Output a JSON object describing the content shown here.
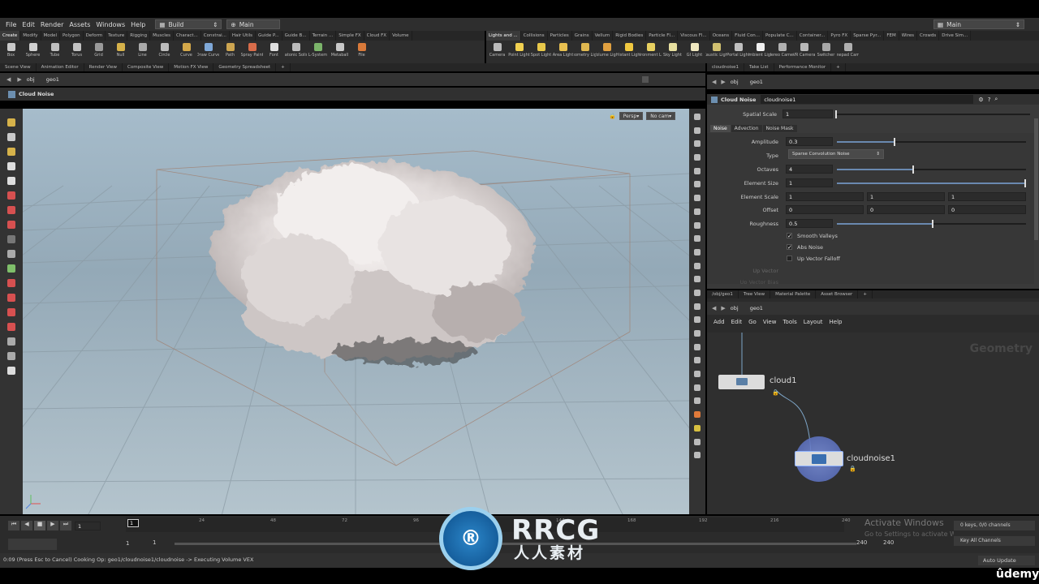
{
  "menubar": {
    "items": [
      "File",
      "Edit",
      "Render",
      "Assets",
      "Windows",
      "Help"
    ],
    "desktop": "Build",
    "context": "Main",
    "right_context": "Main"
  },
  "shelf_left": {
    "tabs": [
      "Create",
      "Modify",
      "Model",
      "Polygon",
      "Deform",
      "Texture",
      "Rigging",
      "Muscles",
      "Charact...",
      "Constrai...",
      "Hair Utils",
      "Guide P...",
      "Guide B...",
      "Terrain ...",
      "Simple FX",
      "Cloud FX",
      "Volume"
    ],
    "tools": [
      {
        "label": "Box",
        "color": "#c9c9c9"
      },
      {
        "label": "Sphere",
        "color": "#d0d0d0"
      },
      {
        "label": "Tube",
        "color": "#c0c0c0"
      },
      {
        "label": "Torus",
        "color": "#c4c4c4"
      },
      {
        "label": "Grid",
        "color": "#9a9a9a"
      },
      {
        "label": "Null",
        "color": "#d6b24a"
      },
      {
        "label": "Line",
        "color": "#aaaaaa"
      },
      {
        "label": "Circle",
        "color": "#bdbdbd"
      },
      {
        "label": "Curve",
        "color": "#d4a84a"
      },
      {
        "label": "Draw Curve",
        "color": "#7fa8d8"
      },
      {
        "label": "Path",
        "color": "#cda550"
      },
      {
        "label": "Spray Paint",
        "color": "#d86c4a"
      },
      {
        "label": "Font",
        "color": "#e0e0e0"
      },
      {
        "label": "Platonic Solids",
        "color": "#bbbbbb"
      },
      {
        "label": "L-System",
        "color": "#7bb46a"
      },
      {
        "label": "Metaball",
        "color": "#c8c8c8"
      },
      {
        "label": "File",
        "color": "#d97a3a"
      }
    ]
  },
  "shelf_right": {
    "tabs": [
      "Lights and ...",
      "Collisions",
      "Particles",
      "Grains",
      "Vellum",
      "Rigid Bodies",
      "Particle Fl...",
      "Viscous Fl...",
      "Oceans",
      "Fluid Con...",
      "Populate C...",
      "Container...",
      "Pyro FX",
      "Sparse Pyr...",
      "FEM",
      "Wires",
      "Crowds",
      "Drive Sim..."
    ],
    "tools": [
      {
        "label": "Camera",
        "color": "#bbbbbb"
      },
      {
        "label": "Point Light",
        "color": "#f0d050"
      },
      {
        "label": "Spot Light",
        "color": "#e8c84a"
      },
      {
        "label": "Area Light",
        "color": "#e8c050"
      },
      {
        "label": "Geometry Light",
        "color": "#e0b850"
      },
      {
        "label": "Volume Light",
        "color": "#e0a040"
      },
      {
        "label": "Distant Light",
        "color": "#f0c840"
      },
      {
        "label": "Environment Light",
        "color": "#e8d060"
      },
      {
        "label": "Sky Light",
        "color": "#e8e0a0"
      },
      {
        "label": "GI Light",
        "color": "#f0e8c0"
      },
      {
        "label": "Caustic Light",
        "color": "#d0c070"
      },
      {
        "label": "Portal Light",
        "color": "#c0c0c0"
      },
      {
        "label": "Ambient Light",
        "color": "#f0f0f0"
      },
      {
        "label": "Stereo Camera",
        "color": "#b0b0b0"
      },
      {
        "label": "VR Camera",
        "color": "#b8b8b8"
      },
      {
        "label": "Switcher",
        "color": "#a8a8a8"
      },
      {
        "label": "Gamepad Camera",
        "color": "#b0b0b0"
      }
    ]
  },
  "left_pane": {
    "tabs": [
      "Scene View",
      "Animation Editor",
      "Render View",
      "Composite View",
      "Motion FX View",
      "Geometry Spreadsheet"
    ],
    "path": [
      "obj",
      "geo1"
    ],
    "title": "Cloud Noise",
    "persp": "Persp",
    "cam": "No cam"
  },
  "param_pane": {
    "tabs": [
      "cloudnoise1",
      "Take List",
      "Performance Monitor"
    ],
    "path": [
      "obj",
      "geo1"
    ],
    "node_type": "Cloud Noise",
    "node_name": "cloudnoise1",
    "spatial_scale": {
      "label": "Spatial Scale",
      "value": "1"
    },
    "subtabs": [
      "Noise",
      "Advection",
      "Noise Mask"
    ],
    "amplitude": {
      "label": "Amplitude",
      "value": "0.3",
      "fraction": 0.3
    },
    "type": {
      "label": "Type",
      "value": "Sparse Convolution Noise"
    },
    "octaves": {
      "label": "Octaves",
      "value": "4",
      "fraction": 0.4
    },
    "element_size": {
      "label": "Element Size",
      "value": "1",
      "fraction": 1.0
    },
    "element_scale": {
      "label": "Element Scale",
      "values": [
        "1",
        "1",
        "1"
      ]
    },
    "offset": {
      "label": "Offset",
      "values": [
        "0",
        "0",
        "0"
      ]
    },
    "roughness": {
      "label": "Roughness",
      "value": "0.5",
      "fraction": 0.5
    },
    "smooth_valleys": {
      "label": "Smooth Valleys",
      "checked": true
    },
    "abs_noise": {
      "label": "Abs Noise",
      "checked": true
    },
    "up_vector_falloff": {
      "label": "Up Vector Falloff",
      "checked": false
    },
    "up_vector": {
      "label": "Up Vector"
    },
    "up_vector_bias": {
      "label": "Up Vector Bias"
    }
  },
  "network_pane": {
    "tabs": [
      "/obj/geo1",
      "Tree View",
      "Material Palette",
      "Asset Browser"
    ],
    "path": [
      "obj",
      "geo1"
    ],
    "menu": [
      "Add",
      "Edit",
      "Go",
      "View",
      "Tools",
      "Layout",
      "Help"
    ],
    "watermark": "Geometry",
    "nodes": [
      "cloud1",
      "cloudnoise1"
    ]
  },
  "timeline": {
    "frame": "1",
    "ticks": [
      "1",
      "24",
      "48",
      "72",
      "96",
      "120",
      "144",
      "168",
      "192",
      "216",
      "240"
    ],
    "start": "1",
    "start2": "1",
    "end": "240",
    "end2": "240",
    "keys": "0 keys, 0/0 channels",
    "key_all": "Key All Channels",
    "activate_title": "Activate Windows",
    "activate_sub": "Go to Settings to activate Windows."
  },
  "status": {
    "text": "0:09 (Press Esc to Cancel) Cooking Op: geo1/cloudnoise1/cloudnoise -> Executing Volume VEX",
    "auto_update": "Auto Update"
  },
  "watermark": {
    "brand": "RRCG",
    "sub": "人人素材",
    "udemy": "ûdemy"
  }
}
